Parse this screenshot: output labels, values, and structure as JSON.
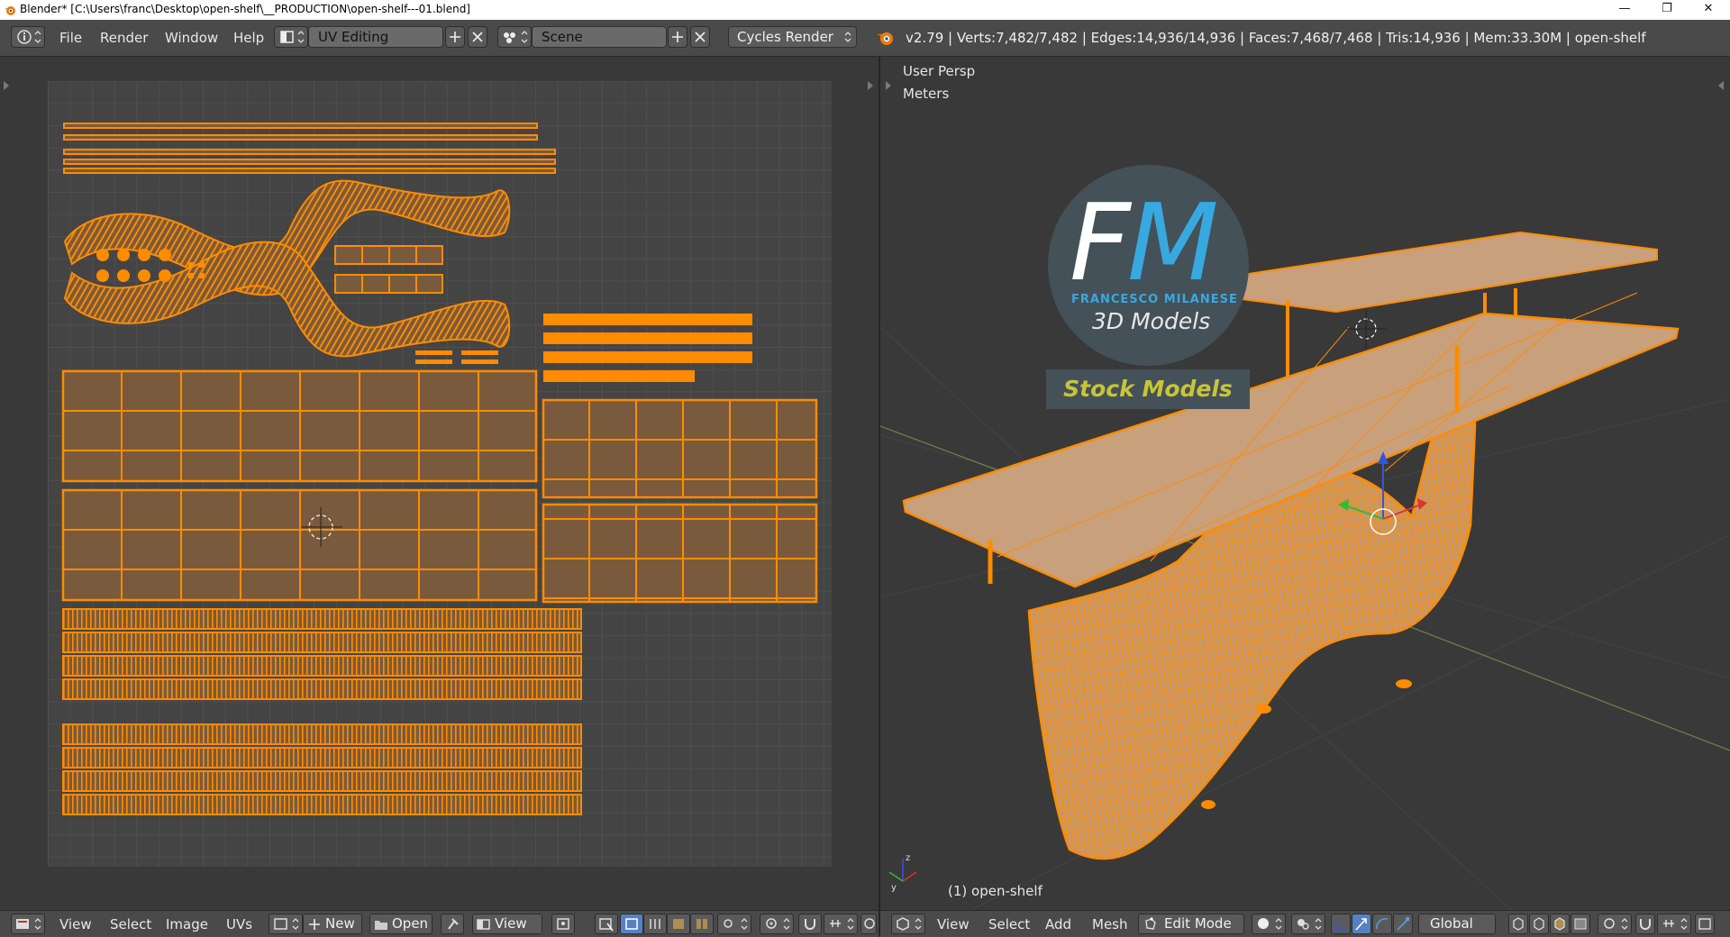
{
  "window": {
    "title": "Blender* [C:\\Users\\franc\\Desktop\\open-shelf\\__PRODUCTION\\open-shelf---01.blend]",
    "minimize": "—",
    "restore": "❐",
    "close": "✕"
  },
  "info_header": {
    "menus": [
      "File",
      "Render",
      "Window",
      "Help"
    ],
    "screen_layout": "UV Editing",
    "scene": "Scene",
    "render_engine": "Cycles Render",
    "stats": "v2.79 | Verts:7,482/7,482 | Edges:14,936/14,936 | Faces:7,468/7,468 | Tris:14,936 | Mem:33.30M | open-shelf"
  },
  "uv_editor": {
    "menus": [
      "View",
      "Select",
      "Image",
      "UVs"
    ],
    "new_label": "New",
    "open_label": "Open",
    "view_label": "View"
  },
  "viewport": {
    "view_name": "User Persp",
    "units": "Meters",
    "object_label": "(1) open-shelf",
    "menus": [
      "View",
      "Select",
      "Add",
      "Mesh"
    ],
    "mode": "Edit Mode",
    "orientation": "Global"
  },
  "logo": {
    "initial_f": "F",
    "initial_m": "M",
    "brand": "FRANCESCO MILANESE",
    "tagline": "3D Models",
    "badge": "Stock Models"
  },
  "colors": {
    "selection": "#ff8c00",
    "face_fill": "#7a5a3c",
    "header": "#4a4a4a",
    "logo_f": "#ffffff",
    "logo_m": "#37a9e0"
  }
}
